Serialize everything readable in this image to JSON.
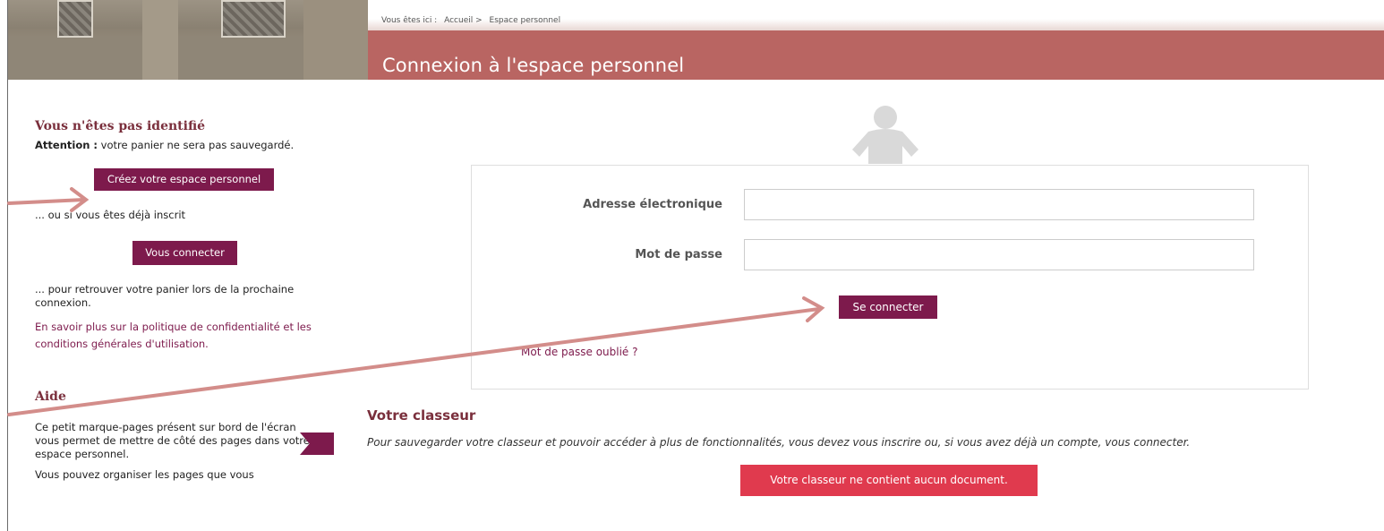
{
  "breadcrumb": {
    "prefix": "Vous êtes ici :",
    "home": "Accueil",
    "sep": ">",
    "current": "Espace personnel"
  },
  "header": {
    "title": "Connexion à l'espace personnel"
  },
  "sidebar": {
    "heading": "Vous n'êtes pas identifié",
    "attention_label": "Attention :",
    "attention_text": " votre panier ne sera pas sauvegardé.",
    "create_button": "Créez votre espace personnel",
    "already_text": "... ou si vous êtes déjà inscrit",
    "connect_button": "Vous connecter",
    "retrieve_text": "... pour retrouver votre panier lors de la prochaine connexion.",
    "privacy_link": "En savoir plus sur la politique de confidentialité et les conditions générales d'utilisation.",
    "aide_heading": "Aide",
    "aide_text": "Ce petit marque-pages présent sur bord de l'écran vous permet de mettre de côté des pages dans votre espace personnel.",
    "aide_text2": "Vous pouvez organiser les pages que vous"
  },
  "login": {
    "email_label": "Adresse électronique",
    "email_value": "",
    "password_label": "Mot de passe",
    "password_value": "",
    "submit_button": "Se connecter",
    "forgot_link": "Mot de passe oublié ?"
  },
  "classeur": {
    "title": "Votre classeur",
    "text": "Pour sauvegarder votre classeur et pouvoir accéder à plus de fonctionnalités, vous devez vous inscrire ou, si vous avez déjà un compte, vous connecter.",
    "empty_notice": "Votre classeur ne contient aucun document."
  },
  "colors": {
    "header_band": "#b96562",
    "accent": "#7d1a4c",
    "notice": "#e03a4e",
    "arrow": "#d38d8a"
  },
  "icons": {
    "person": "person-icon",
    "bookmark": "bookmark-ribbon-icon"
  }
}
